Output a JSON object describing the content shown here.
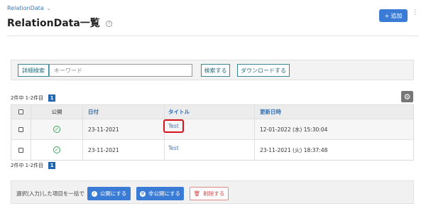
{
  "breadcrumb": {
    "label": "RelationData",
    "chevron": "chevron-down-icon"
  },
  "page": {
    "title": "RelationData一覧",
    "help": "?"
  },
  "header_actions": {
    "add_label": "追加",
    "add_icon": "+",
    "more": "⋮"
  },
  "search": {
    "advanced_label": "詳細検索",
    "placeholder": "キーワード",
    "submit_label": "検索する",
    "download_label": "ダウンロードする"
  },
  "pagination_top": {
    "summary": "2件中 1-2件目",
    "page": "1"
  },
  "pagination_bottom": {
    "summary": "2件中 1-2件目",
    "page": "1"
  },
  "settings": {
    "icon": "gear-icon",
    "glyph": "⚙"
  },
  "table": {
    "headers": {
      "public": "公開",
      "date": "日付",
      "title": "タイトル",
      "updated": "更新日時"
    },
    "rows": [
      {
        "public": true,
        "date": "23-11-2021",
        "title": "Test",
        "updated": "12-01-2022 (水) 15:30:04",
        "highlighted": true
      },
      {
        "public": true,
        "date": "23-11-2021",
        "title": "Test",
        "updated": "23-11-2021 (火) 18:37:48",
        "highlighted": false
      }
    ]
  },
  "bulk": {
    "label": "選択(入力)した項目を一括で",
    "publish_label": "公開にする",
    "unpublish_label": "非公開にする",
    "delete_label": "削除する"
  },
  "colors": {
    "primary": "#3a7bd5",
    "accent_teal": "#3a8896",
    "danger": "#d8121a",
    "success": "#3aa45a"
  }
}
